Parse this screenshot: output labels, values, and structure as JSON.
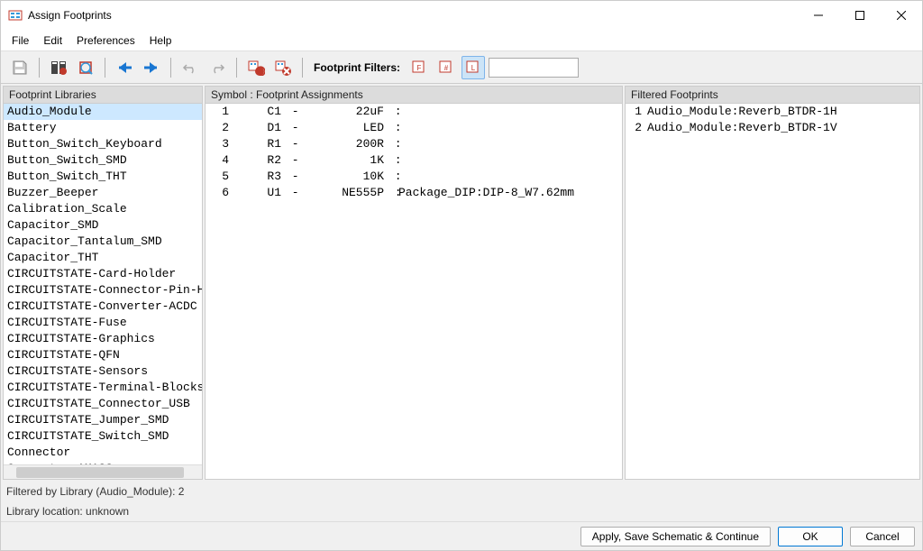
{
  "window": {
    "title": "Assign Footprints"
  },
  "menu": {
    "file": "File",
    "edit": "Edit",
    "preferences": "Preferences",
    "help": "Help"
  },
  "toolbar": {
    "filter_label": "Footprint Filters:",
    "search_value": ""
  },
  "panels": {
    "libs_header": "Footprint Libraries",
    "symbols_header": "Symbol : Footprint Assignments",
    "filtered_header": "Filtered Footprints"
  },
  "libraries": {
    "items": [
      "Audio_Module",
      "Battery",
      "Button_Switch_Keyboard",
      "Button_Switch_SMD",
      "Button_Switch_THT",
      "Buzzer_Beeper",
      "Calibration_Scale",
      "Capacitor_SMD",
      "Capacitor_Tantalum_SMD",
      "Capacitor_THT",
      "CIRCUITSTATE-Card-Holder",
      "CIRCUITSTATE-Connector-Pin-He",
      "CIRCUITSTATE-Converter-ACDC",
      "CIRCUITSTATE-Fuse",
      "CIRCUITSTATE-Graphics",
      "CIRCUITSTATE-QFN",
      "CIRCUITSTATE-Sensors",
      "CIRCUITSTATE-Terminal-Blocks",
      "CIRCUITSTATE_Connector_USB",
      "CIRCUITSTATE_Jumper_SMD",
      "CIRCUITSTATE_Switch_SMD",
      "Connector",
      "Connector_AMASS"
    ],
    "selected_index": 0
  },
  "symbols": {
    "rows": [
      {
        "idx": "1",
        "ref": "C1",
        "val": "22uF",
        "fp": ""
      },
      {
        "idx": "2",
        "ref": "D1",
        "val": "LED",
        "fp": ""
      },
      {
        "idx": "3",
        "ref": "R1",
        "val": "200R",
        "fp": ""
      },
      {
        "idx": "4",
        "ref": "R2",
        "val": "1K",
        "fp": ""
      },
      {
        "idx": "5",
        "ref": "R3",
        "val": "10K",
        "fp": ""
      },
      {
        "idx": "6",
        "ref": "U1",
        "val": "NE555P",
        "fp": "Package_DIP:DIP-8_W7.62mm"
      }
    ]
  },
  "filtered": {
    "rows": [
      {
        "idx": "1",
        "name": "Audio_Module:Reverb_BTDR-1H"
      },
      {
        "idx": "2",
        "name": "Audio_Module:Reverb_BTDR-1V"
      }
    ]
  },
  "status": {
    "line1": "Filtered by Library (Audio_Module): 2",
    "line2": "Library location: unknown"
  },
  "buttons": {
    "apply": "Apply, Save Schematic & Continue",
    "ok": "OK",
    "cancel": "Cancel"
  }
}
